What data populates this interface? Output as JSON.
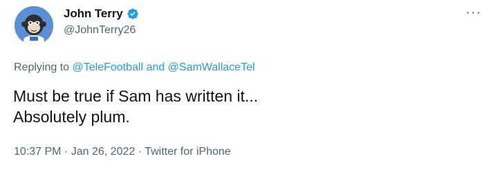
{
  "author": {
    "display_name": "John Terry",
    "handle": "@JohnTerry26",
    "verified": true,
    "avatar_icon": "ape-avatar-icon"
  },
  "reply": {
    "prefix": "Replying to",
    "user1": "@TeleFootball",
    "conjunction": "and",
    "user2": "@SamWallaceTel"
  },
  "tweet": {
    "lines": [
      "Must be true if Sam has written it...",
      "Absolutely plum."
    ]
  },
  "meta": {
    "time": "10:37 PM",
    "separator": "·",
    "date": "Jan 26, 2022",
    "source": "Twitter for iPhone"
  },
  "menu": {
    "more_label": "···"
  },
  "colors": {
    "link": "#1d9bf0",
    "secondary_text": "#536471",
    "primary_text": "#0f1419"
  }
}
